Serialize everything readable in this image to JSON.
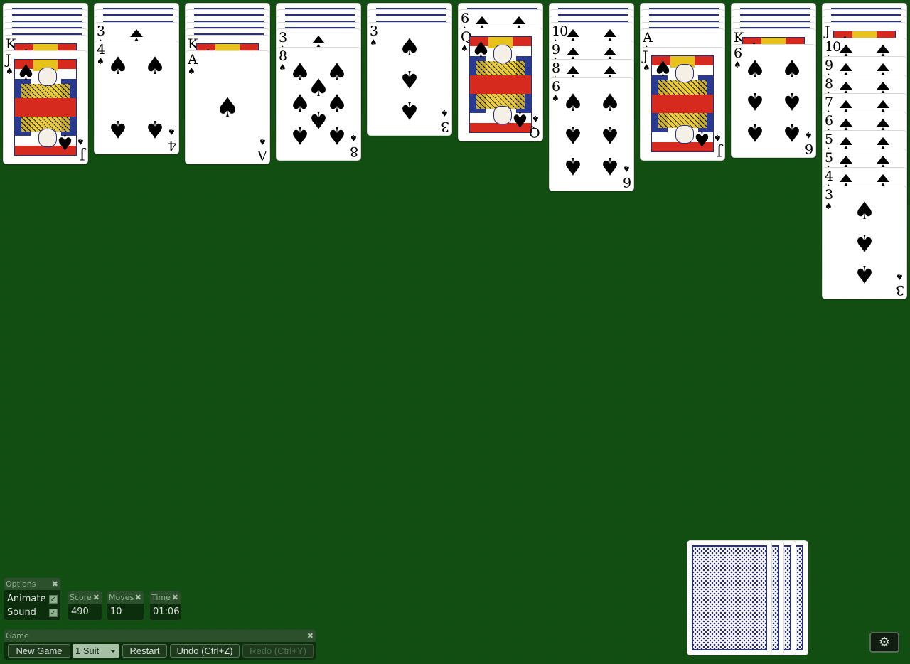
{
  "tableau": {
    "suit_glyph": "♠",
    "piles": [
      {
        "face_down": 5,
        "face_up": [
          {
            "rank": "K",
            "kind": "face",
            "partial": true
          },
          {
            "rank": "J",
            "kind": "face"
          }
        ]
      },
      {
        "face_down": 3,
        "face_up": [
          {
            "rank": "3",
            "kind": "pips"
          },
          {
            "rank": "4",
            "kind": "pips"
          }
        ]
      },
      {
        "face_down": 5,
        "face_up": [
          {
            "rank": "K",
            "kind": "face",
            "partial": true
          },
          {
            "rank": "A",
            "kind": "pips"
          }
        ]
      },
      {
        "face_down": 4,
        "face_up": [
          {
            "rank": "3",
            "kind": "pips"
          },
          {
            "rank": "8",
            "kind": "pips"
          }
        ]
      },
      {
        "face_down": 3,
        "face_up": [
          {
            "rank": "3",
            "kind": "pips"
          }
        ]
      },
      {
        "face_down": 1,
        "face_up": [
          {
            "rank": "6",
            "kind": "pips"
          },
          {
            "rank": "Q",
            "kind": "face"
          }
        ]
      },
      {
        "face_down": 3,
        "face_up": [
          {
            "rank": "10",
            "kind": "pips"
          },
          {
            "rank": "9",
            "kind": "pips"
          },
          {
            "rank": "8",
            "kind": "pips"
          },
          {
            "rank": "6",
            "kind": "pips"
          }
        ]
      },
      {
        "face_down": 4,
        "face_up": [
          {
            "rank": "A",
            "kind": "pips"
          },
          {
            "rank": "J",
            "kind": "face"
          }
        ]
      },
      {
        "face_down": 4,
        "face_up": [
          {
            "rank": "K",
            "kind": "face",
            "partial": true
          },
          {
            "rank": "6",
            "kind": "pips"
          }
        ]
      },
      {
        "face_down": 3,
        "face_up": [
          {
            "rank": "J",
            "kind": "face",
            "partial": true
          },
          {
            "rank": "10",
            "kind": "pips"
          },
          {
            "rank": "9",
            "kind": "pips"
          },
          {
            "rank": "8",
            "kind": "pips"
          },
          {
            "rank": "7",
            "kind": "pips"
          },
          {
            "rank": "6",
            "kind": "pips"
          },
          {
            "rank": "5",
            "kind": "pips"
          },
          {
            "rank": "5",
            "kind": "pips"
          },
          {
            "rank": "4",
            "kind": "pips"
          },
          {
            "rank": "3",
            "kind": "pips"
          }
        ]
      }
    ]
  },
  "stock": {
    "remaining_deals": 4
  },
  "options": {
    "title": "Options",
    "close_icon": "✖",
    "animate_label": "Animate",
    "animate_checked": true,
    "sound_label": "Sound",
    "sound_checked": true,
    "check_glyph": "✓"
  },
  "score": {
    "title": "Score",
    "value": "490"
  },
  "moves": {
    "title": "Moves",
    "value": "10"
  },
  "time": {
    "title": "Time",
    "value": "01:06"
  },
  "game": {
    "title": "Game",
    "new_game": "New Game",
    "suit_select": "1 Suit",
    "restart": "Restart",
    "undo": "Undo (Ctrl+Z)",
    "redo": "Redo (Ctrl+Y)",
    "redo_enabled": false
  },
  "settings": {
    "icon": "⚙"
  },
  "colors": {
    "felt": "#124f12",
    "card_back": "#27307a",
    "face_red": "#d52a1d",
    "face_gold": "#e6c21a"
  }
}
